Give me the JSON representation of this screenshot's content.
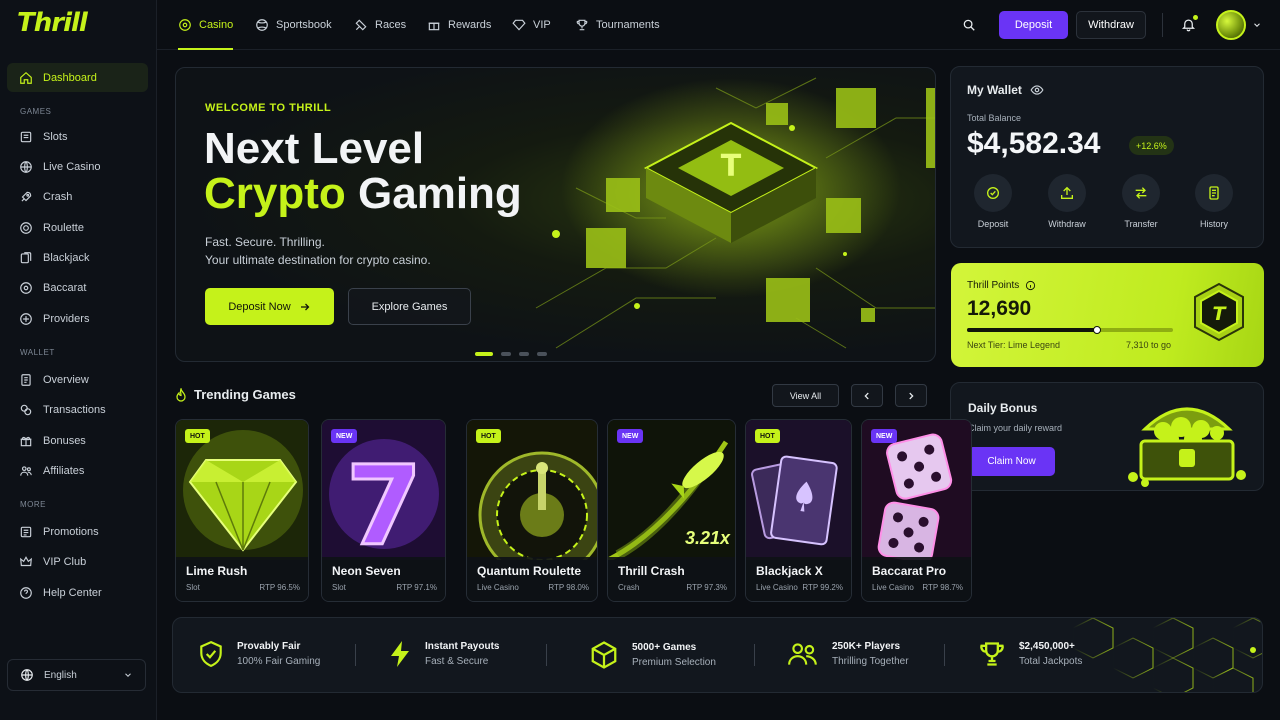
{
  "brand": {
    "logo": "Thrill"
  },
  "colors": {
    "accent": "#c5f21a",
    "purple": "#6a34f5",
    "bg": "#0b0e13"
  },
  "topnav": {
    "tabs": [
      {
        "label": "Casino",
        "icon": "casino-chip-icon",
        "active": true
      },
      {
        "label": "Sportsbook",
        "icon": "ball-icon"
      },
      {
        "label": "Races",
        "icon": "race-icon"
      },
      {
        "label": "Rewards",
        "icon": "gift-icon"
      },
      {
        "label": "VIP",
        "icon": "diamond-icon"
      },
      {
        "label": "Tournaments",
        "icon": "trophy-icon"
      }
    ],
    "deposit_label": "Deposit",
    "withdraw_label": "Withdraw"
  },
  "sidebar": {
    "dashboard": "Dashboard",
    "games_heading": "GAMES",
    "games": [
      "Slots",
      "Live Casino",
      "Crash",
      "Roulette",
      "Blackjack",
      "Baccarat",
      "Providers"
    ],
    "wallet_heading": "WALLET",
    "wallet": [
      "Overview",
      "Transactions",
      "Bonuses",
      "Affiliates"
    ],
    "more_heading": "MORE",
    "more": [
      "Promotions",
      "VIP Club",
      "Help Center"
    ],
    "language": "English"
  },
  "hero": {
    "eyebrow": "WELCOME TO THRILL",
    "title_line1": "Next Level",
    "title_accent": "Crypto",
    "title_rest": " Gaming",
    "subtitle_line1": "Fast. Secure. Thrilling.",
    "subtitle_line2": "Your ultimate destination for crypto casino.",
    "primary_button": "Deposit Now",
    "secondary_button": "Explore Games",
    "slide_count": 4,
    "active_slide": 1
  },
  "wallet": {
    "title": "My Wallet",
    "balance_label": "Total Balance",
    "balance": "$4,582.34",
    "change": "+12.6%",
    "actions": [
      "Deposit",
      "Withdraw",
      "Transfer",
      "History"
    ]
  },
  "points": {
    "title": "Thrill Points",
    "value": "12,690",
    "progress": 0.63,
    "next_tier": "Next Tier: Lime Legend",
    "to_go": "7,310 to go"
  },
  "bonus": {
    "title": "Daily Bonus",
    "subtitle": "Claim your daily reward",
    "button": "Claim Now"
  },
  "trending": {
    "title": "Trending Games",
    "view_all": "View All",
    "games": [
      {
        "badge": "HOT",
        "name": "Lime Rush",
        "category": "Slot",
        "rtp": "RTP 96.5%"
      },
      {
        "badge": "NEW",
        "name": "Neon Seven",
        "category": "Slot",
        "rtp": "RTP 97.1%"
      },
      {
        "badge": "HOT",
        "name": "Quantum Roulette",
        "category": "Live Casino",
        "rtp": "RTP 98.0%"
      },
      {
        "badge": "NEW",
        "name": "Thrill Crash",
        "category": "Crash",
        "rtp": "RTP 97.3%",
        "multiplier": "3.21x"
      },
      {
        "badge": "HOT",
        "name": "Blackjack X",
        "category": "Live Casino",
        "rtp": "RTP 99.2%"
      },
      {
        "badge": "NEW",
        "name": "Baccarat Pro",
        "category": "Live Casino",
        "rtp": "RTP 98.7%"
      }
    ]
  },
  "stats": [
    {
      "title": "Provably Fair",
      "subtitle": "100% Fair Gaming",
      "icon": "shield-check-icon"
    },
    {
      "title": "Instant Payouts",
      "subtitle": "Fast & Secure",
      "icon": "lightning-icon"
    },
    {
      "title": "5000+ Games",
      "subtitle": "Premium Selection",
      "icon": "cube-icon"
    },
    {
      "title": "250K+ Players",
      "subtitle": "Thrilling Together",
      "icon": "users-icon"
    },
    {
      "title": "$2,450,000+",
      "subtitle": "Total Jackpots",
      "icon": "trophy-icon"
    }
  ]
}
